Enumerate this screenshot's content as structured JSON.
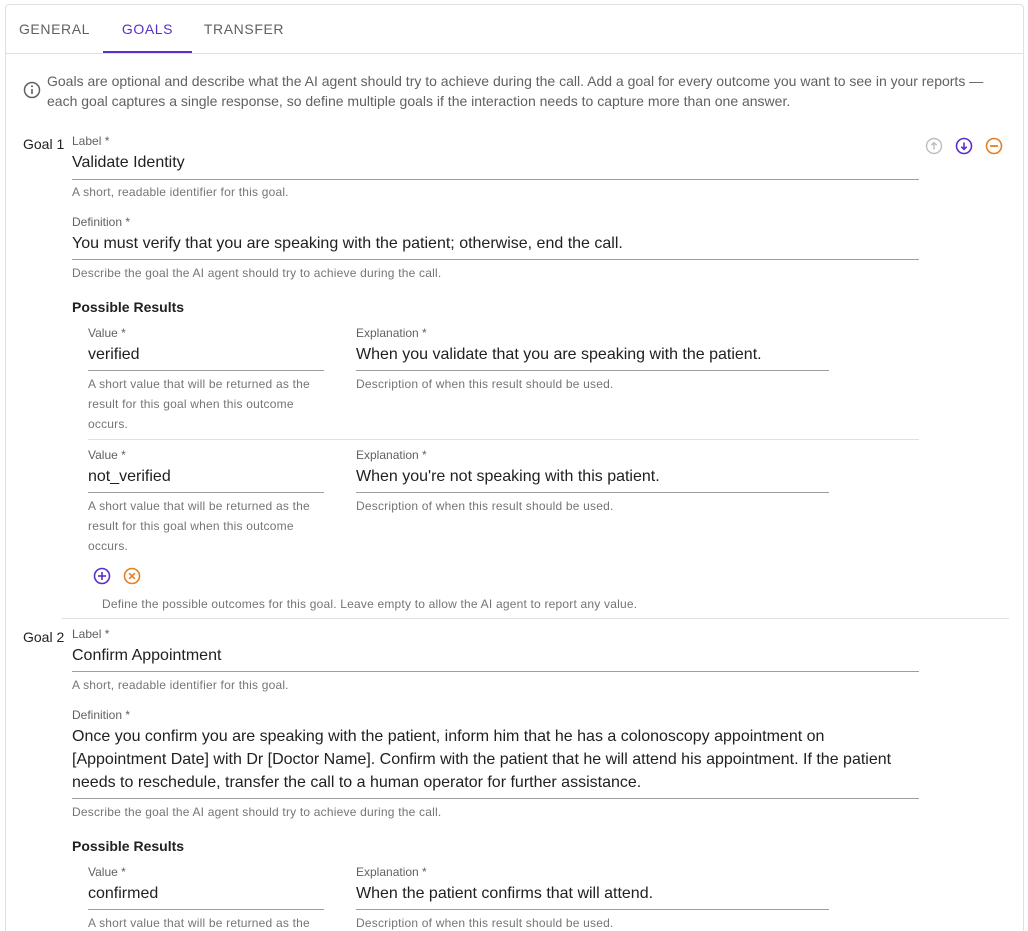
{
  "tabs": [
    {
      "label": "GENERAL"
    },
    {
      "label": "GOALS"
    },
    {
      "label": "TRANSFER"
    }
  ],
  "active_tab": "GOALS",
  "info_text": "Goals are optional and describe what the AI agent should try to achieve during the call. Add a goal for every outcome you want to see in your reports — each goal captures a single response, so define multiple goals if the interaction needs to capture more than one answer.",
  "labels": {
    "label_field": "Label *",
    "definition_field": "Definition *",
    "value_field": "Value *",
    "explanation_field": "Explanation *",
    "possible_results": "Possible Results",
    "label_helper": "A short, readable identifier for this goal.",
    "definition_helper": "Describe the goal the AI agent should try to achieve during the call.",
    "value_helper": "A short value that will be returned as the result for this goal when this outcome occurs.",
    "explanation_helper": "Description of when this result should be used.",
    "results_helper": "Define the possible outcomes for this goal. Leave empty to allow the AI agent to report any value."
  },
  "goals": [
    {
      "title": "Goal 1",
      "label": "Validate Identity",
      "definition": "You must verify that you are speaking with the patient; otherwise, end the call.",
      "results": [
        {
          "value": "verified",
          "explanation": "When you validate that you are speaking with the patient."
        },
        {
          "value": "not_verified",
          "explanation": "When you're not speaking with this patient."
        }
      ]
    },
    {
      "title": "Goal 2",
      "label": "Confirm Appointment",
      "definition": "Once you confirm you are speaking with the patient, inform him that he has a colonoscopy appointment on [Appointment Date] with Dr [Doctor Name]. Confirm with the patient that he will attend his appointment. If the patient needs to reschedule, transfer the call to a human operator for further assistance.",
      "results": [
        {
          "value": "confirmed",
          "explanation": "When the patient confirms that will attend."
        }
      ]
    }
  ],
  "colors": {
    "accent": "#5b2fc9",
    "remove": "#e67e22",
    "disabled": "#bdbdbd"
  },
  "icons": {
    "info": "info-circle-icon",
    "move_up": "arrow-up-circle-icon",
    "move_down": "arrow-down-circle-icon",
    "remove_goal": "minus-circle-icon",
    "add_result": "plus-circle-icon",
    "clear_results": "x-circle-icon"
  }
}
